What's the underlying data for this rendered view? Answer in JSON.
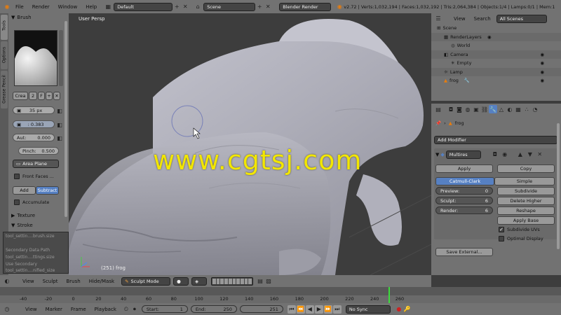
{
  "top_bar": {
    "menus": [
      "File",
      "Render",
      "Window",
      "Help"
    ],
    "layout": "Default",
    "scene": "Scene",
    "engine": "Blender Render",
    "stats": "v2.72 | Verts:1,032,194 | Faces:1,032,192 | Tris:2,064,384 | Objects:1/4 | Lamps:0/1 | Mem:1"
  },
  "left_tabs": [
    "Tools",
    "Options",
    "Grease Pencil"
  ],
  "tool_panel": {
    "brush_header": "Brush",
    "brush_name": "Crea",
    "brush_users": "2",
    "brush_f": "F",
    "radius": "35 px",
    "strength": ": 0.383",
    "autosmooth_label": "Aut:",
    "autosmooth_value": "0.000",
    "pinch_label": "Pinch:",
    "pinch_value": "0.500",
    "plane": "Area Plane",
    "front_faces": "Front Faces ...",
    "add_label": "Add",
    "subtract_label": "Subtract",
    "accumulate": "Accumulate",
    "texture_header": "Texture",
    "stroke_header": "Stroke",
    "tooltip_1": "tool_settin....brush.size",
    "secondary_label": "Secondary Data Path",
    "tooltip_2": "tool_settin....ttings.size",
    "use_secondary_label": "Use Secondary",
    "tooltip_3": "tool_settin....nified_size"
  },
  "viewport": {
    "view_label": "User Persp",
    "object_label": "(251) frog",
    "watermark": "www.cgtsj.com"
  },
  "viewport_header": {
    "menus": [
      "View",
      "Sculpt",
      "Brush",
      "Hide/Mask"
    ],
    "mode": "Sculpt Mode"
  },
  "outliner": {
    "menus": [
      "View",
      "Search"
    ],
    "filter": "All Scenes",
    "items": [
      {
        "label": "Scene",
        "indent": 0
      },
      {
        "label": "RenderLayers",
        "indent": 1
      },
      {
        "label": "World",
        "indent": 1
      },
      {
        "label": "Camera",
        "indent": 1
      },
      {
        "label": "Empty",
        "indent": 1
      },
      {
        "label": "Lamp",
        "indent": 1
      },
      {
        "label": "frog",
        "indent": 1
      }
    ]
  },
  "properties": {
    "object_name": "frog",
    "add_modifier": "Add Modifier",
    "modifier_name": "Multires",
    "apply": "Apply",
    "copy": "Copy",
    "catmull": "Catmull-Clark",
    "simple": "Simple",
    "preview_label": "Preview:",
    "preview_value": "0",
    "sculpt_label": "Sculpt:",
    "sculpt_value": "6",
    "render_label": "Render:",
    "render_value": "6",
    "subdivide": "Subdivide",
    "delete_higher": "Delete Higher",
    "reshape": "Reshape",
    "apply_base": "Apply Base",
    "subdivide_uvs": "Subdivide UVs",
    "optimal_display": "Optimal Display",
    "save_external": "Save External..."
  },
  "timeline": {
    "ticks": [
      "-40",
      "-20",
      "0",
      "20",
      "40",
      "60",
      "80",
      "100",
      "120",
      "140",
      "160",
      "180",
      "200",
      "220",
      "240",
      "260"
    ],
    "current_frame": 251,
    "menus": [
      "View",
      "Marker",
      "Frame",
      "Playback"
    ],
    "start_label": "Start:",
    "start_value": "1",
    "end_label": "End:",
    "end_value": "250",
    "frame_value": "251",
    "sync": "No Sync"
  },
  "colors": {
    "header": "#727272",
    "viewport": "#3d3d3d",
    "accent_blue": "#5680c2",
    "watermark": "#f2e600",
    "timeline_marker": "#3cdc3c"
  }
}
